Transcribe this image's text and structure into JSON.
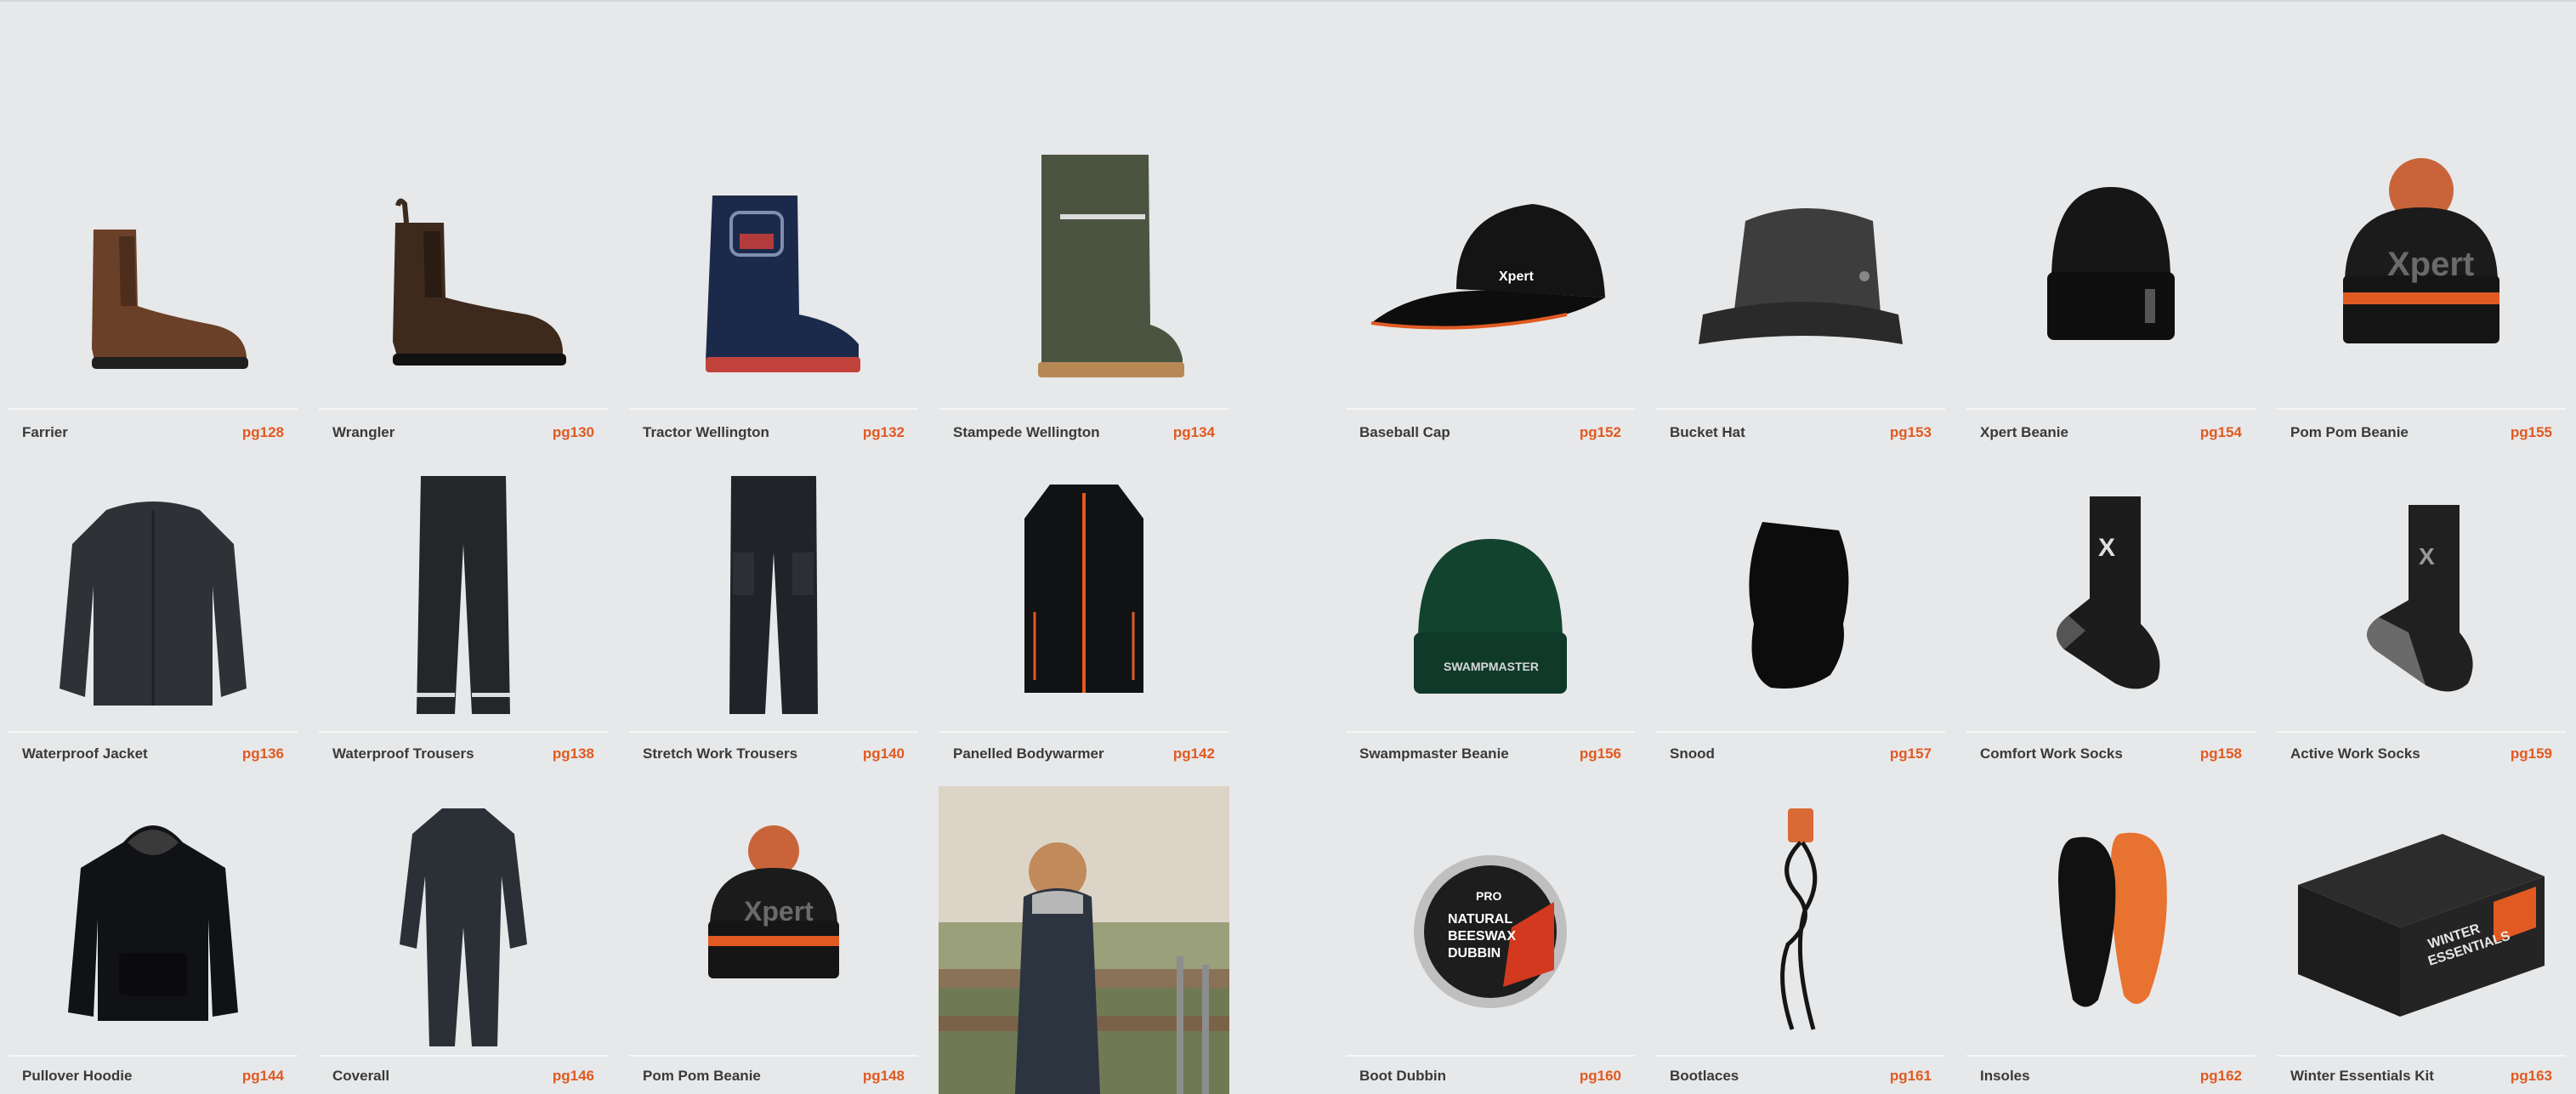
{
  "accent_color": "#e05a22",
  "products": [
    {
      "name": "Farrier",
      "page": "pg128",
      "icon": "chelsea-boot-brown"
    },
    {
      "name": "Wrangler",
      "page": "pg130",
      "icon": "chelsea-boot-dark"
    },
    {
      "name": "Tractor Wellington",
      "page": "pg132",
      "icon": "kids-wellington"
    },
    {
      "name": "Stampede Wellington",
      "page": "pg134",
      "icon": "green-wellington"
    },
    {
      "name": "Baseball Cap",
      "page": "pg152",
      "icon": "baseball-cap"
    },
    {
      "name": "Bucket Hat",
      "page": "pg153",
      "icon": "bucket-hat"
    },
    {
      "name": "Xpert Beanie",
      "page": "pg154",
      "icon": "beanie"
    },
    {
      "name": "Pom Pom Beanie",
      "page": "pg155",
      "icon": "pom-pom-beanie"
    },
    {
      "name": "Waterproof Jacket",
      "page": "pg136",
      "icon": "jacket"
    },
    {
      "name": "Waterproof Trousers",
      "page": "pg138",
      "icon": "waterproof-trousers"
    },
    {
      "name": "Stretch Work Trousers",
      "page": "pg140",
      "icon": "work-trousers"
    },
    {
      "name": "Panelled Bodywarmer",
      "page": "pg142",
      "icon": "bodywarmer"
    },
    {
      "name": "Swampmaster Beanie",
      "page": "pg156",
      "icon": "green-beanie"
    },
    {
      "name": "Snood",
      "page": "pg157",
      "icon": "snood"
    },
    {
      "name": "Comfort Work Socks",
      "page": "pg158",
      "icon": "sock"
    },
    {
      "name": "Active Work Socks",
      "page": "pg159",
      "icon": "sock-grey"
    },
    {
      "name": "Pullover Hoodie",
      "page": "pg144",
      "icon": "hoodie"
    },
    {
      "name": "Coverall",
      "page": "pg146",
      "icon": "coverall"
    },
    {
      "name": "Pom Pom Beanie",
      "page": "pg148",
      "icon": "pom-pom-beanie"
    },
    {
      "name": "",
      "page": "",
      "icon": "child-photo"
    },
    {
      "name": "Boot Dubbin",
      "page": "pg160",
      "icon": "dubbin-tin"
    },
    {
      "name": "Bootlaces",
      "page": "pg161",
      "icon": "bootlaces"
    },
    {
      "name": "Insoles",
      "page": "pg162",
      "icon": "insoles"
    },
    {
      "name": "Winter Essentials Kit",
      "page": "pg163",
      "icon": "gift-box"
    }
  ],
  "labels": {
    "cap_brand": "Xpert",
    "beanie_brand": "Xpert",
    "swamp_brand": "SWAMPMASTER",
    "dubbin_pro": "PRO",
    "dubbin_l1": "NATURAL",
    "dubbin_l2": "BEESWAX",
    "dubbin_l3": "DUBBIN",
    "box_l1": "WINTER",
    "box_l2": "ESSENTIALS"
  }
}
